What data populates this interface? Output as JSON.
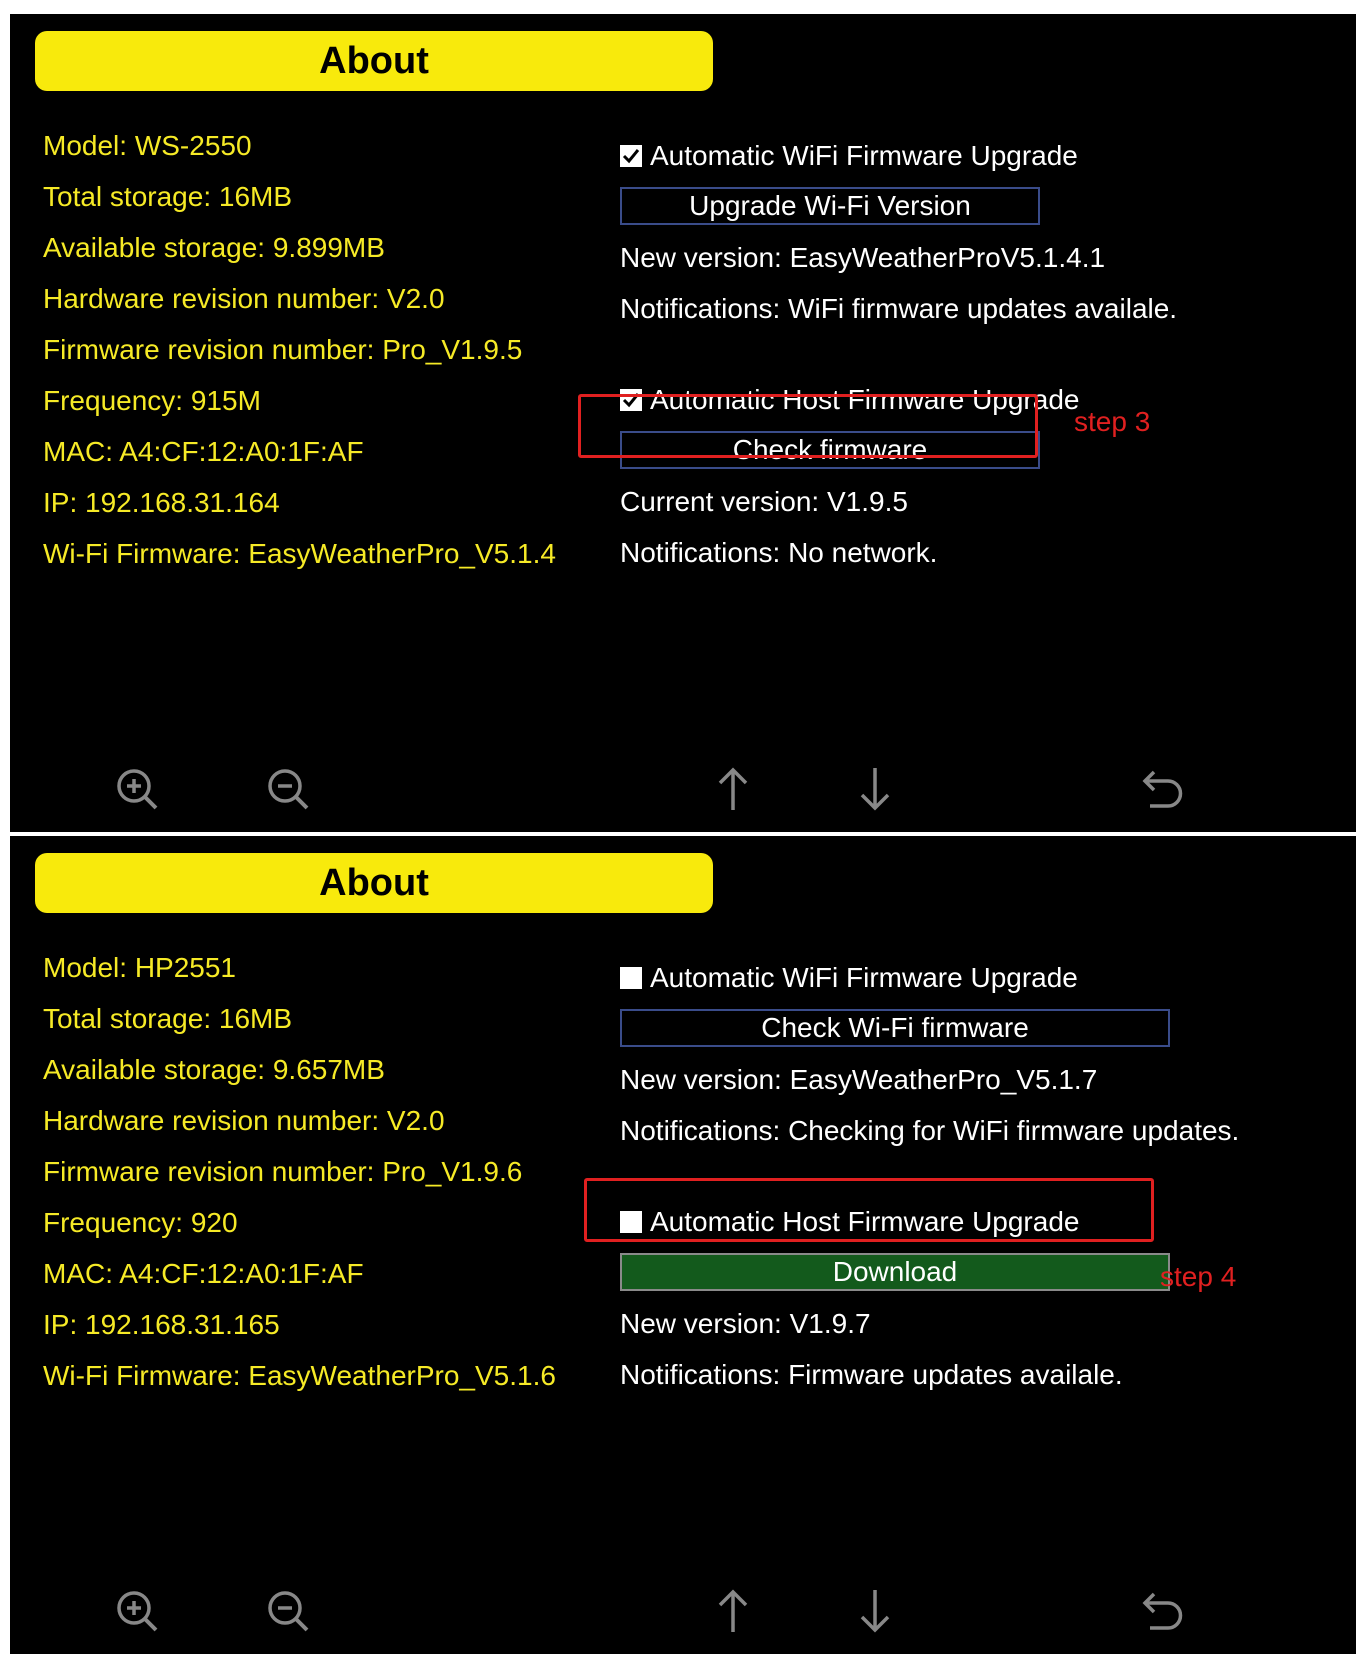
{
  "top": {
    "title": "About",
    "info": [
      "Model: WS-2550",
      "Total storage: 16MB",
      "Available storage: 9.899MB",
      "Hardware revision number: V2.0",
      "Firmware revision number: Pro_V1.9.5",
      "Frequency: 915M",
      "MAC: A4:CF:12:A0:1F:AF",
      "IP: 192.168.31.164",
      "Wi-Fi Firmware: EasyWeatherPro_V5.1.4"
    ],
    "wifi_checkbox_label": "Automatic WiFi Firmware Upgrade",
    "wifi_checkbox_checked": true,
    "wifi_button": "Upgrade Wi-Fi Version",
    "wifi_version": "New version: EasyWeatherProV5.1.4.1",
    "wifi_notification": "Notifications: WiFi firmware updates availale.",
    "host_checkbox_label": "Automatic Host Firmware Upgrade",
    "host_checkbox_checked": true,
    "host_button": "Check firmware",
    "host_version": "Current version: V1.9.5",
    "host_notification": "Notifications: No network.",
    "annotation": "step 3"
  },
  "bottom": {
    "title": "About",
    "info": [
      "Model: HP2551",
      "Total storage: 16MB",
      "Available storage: 9.657MB",
      "Hardware revision number: V2.0",
      "Firmware revision number: Pro_V1.9.6",
      "Frequency: 920",
      "MAC: A4:CF:12:A0:1F:AF",
      "IP: 192.168.31.165",
      "Wi-Fi Firmware: EasyWeatherPro_V5.1.6"
    ],
    "wifi_checkbox_label": "Automatic WiFi Firmware Upgrade",
    "wifi_checkbox_checked": false,
    "wifi_button": "Check Wi-Fi firmware",
    "wifi_version": "New version: EasyWeatherPro_V5.1.7",
    "wifi_notification": "Notifications: Checking for WiFi firmware updates.",
    "host_checkbox_label": "Automatic Host Firmware Upgrade",
    "host_checkbox_checked": false,
    "host_button": "Download",
    "host_version": "New version: V1.9.7",
    "host_notification": "Notifications: Firmware updates availale.",
    "annotation": "step 4"
  },
  "toolbar_icons": [
    "zoom-in-icon",
    "zoom-out-icon",
    "arrow-up-icon",
    "arrow-down-icon",
    "back-icon"
  ],
  "colors": {
    "title_bg": "#f8ea0c",
    "info_text": "#f6ea26",
    "annotation": "#e02020",
    "download_bg": "#135a1c"
  }
}
